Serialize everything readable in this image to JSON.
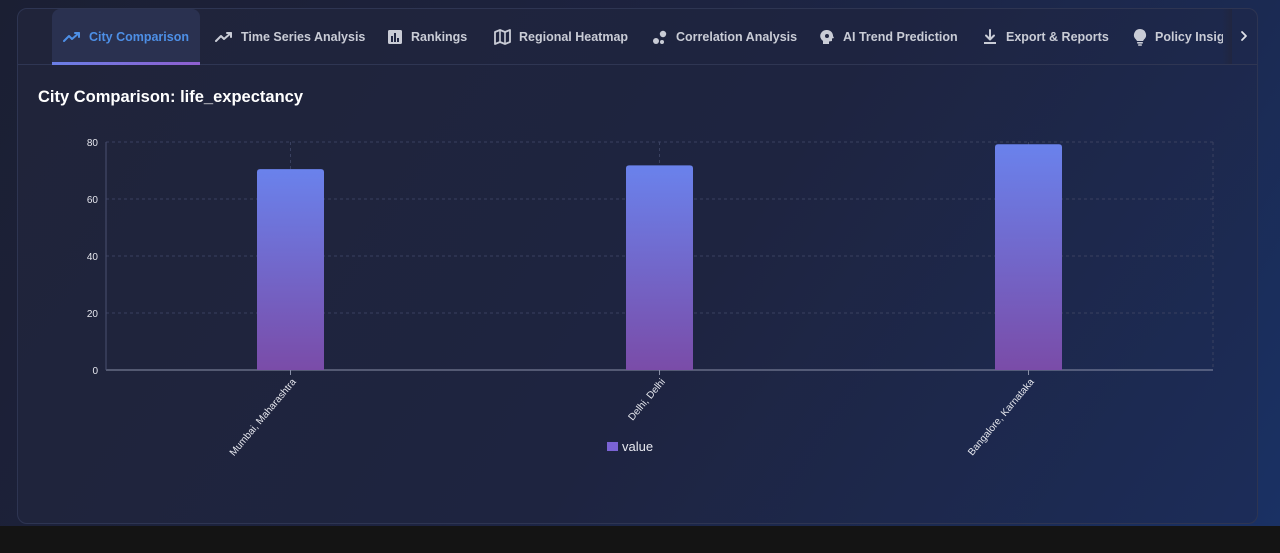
{
  "tabs": [
    {
      "label": "City Comparison",
      "icon": "trending-up-icon",
      "active": true
    },
    {
      "label": "Time Series Analysis",
      "icon": "line-chart-icon",
      "active": false
    },
    {
      "label": "Rankings",
      "icon": "bar-chart-icon",
      "active": false
    },
    {
      "label": "Regional Heatmap",
      "icon": "map-icon",
      "active": false
    },
    {
      "label": "Correlation Analysis",
      "icon": "scatter-icon",
      "active": false
    },
    {
      "label": "AI Trend Prediction",
      "icon": "brain-icon",
      "active": false
    },
    {
      "label": "Export & Reports",
      "icon": "download-icon",
      "active": false
    },
    {
      "label": "Policy Insights",
      "icon": "lightbulb-icon",
      "active": false
    }
  ],
  "colors": {
    "accent": "#4d8fe6",
    "bar_top": "#6a82ec",
    "bar_bottom": "#7a4ca8",
    "grid": "#3a4160"
  },
  "chart_data": {
    "type": "bar",
    "title": "City Comparison: life_expectancy",
    "categories": [
      "Mumbai, Maharashtra",
      "Delhi, Delhi",
      "Bangalore, Karnataka"
    ],
    "series": [
      {
        "name": "value",
        "values": [
          70.5,
          71.8,
          79.2
        ]
      }
    ],
    "ylim": [
      0,
      80
    ],
    "yticks": [
      0,
      20,
      40,
      60,
      80
    ],
    "grid": true,
    "legend": "bottom-center",
    "xlabel": "",
    "ylabel": ""
  }
}
